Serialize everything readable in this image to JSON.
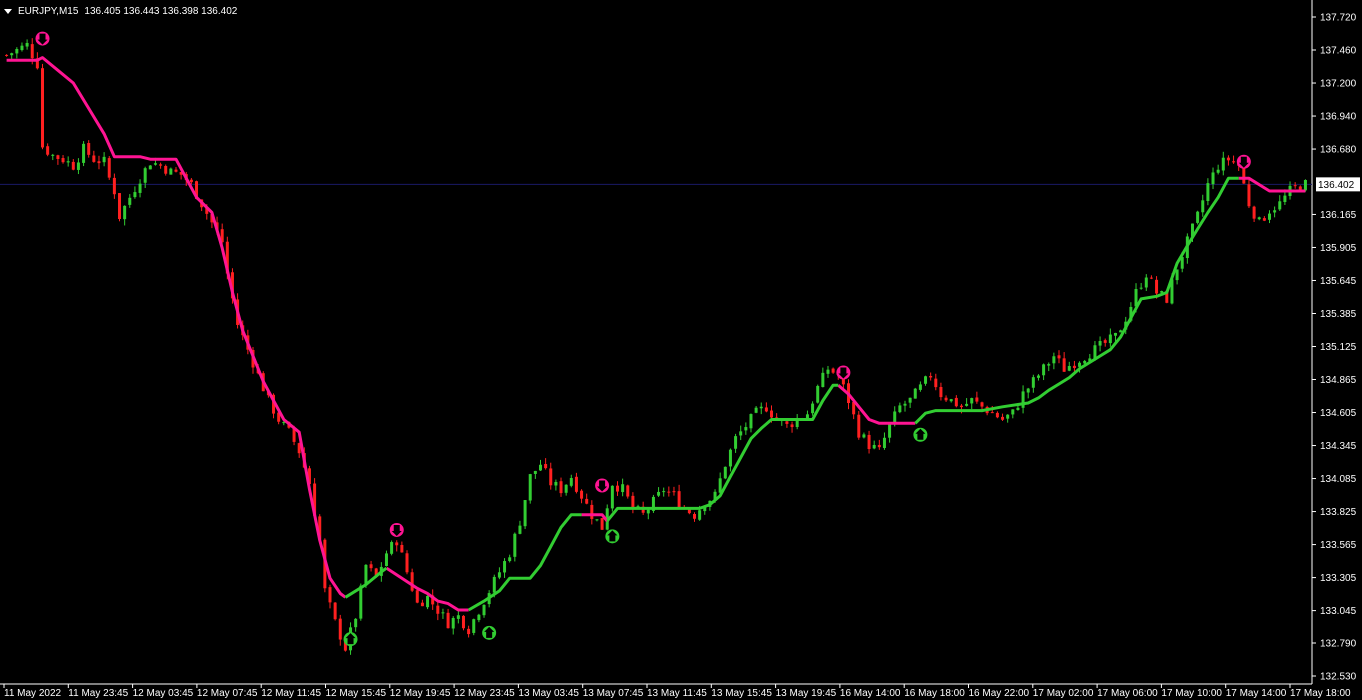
{
  "header": {
    "symbol": "EURJPY,M15",
    "ohlc": "136.405 136.443 136.398 136.402"
  },
  "colors": {
    "background": "#000000",
    "bull": "#32cd32",
    "bear": "#ff2020",
    "trail_up": "#32cd32",
    "trail_down": "#ff1493",
    "axis": "#ffffff",
    "price_line": "#1a1a66"
  },
  "chart_data": {
    "type": "line",
    "symbol": "EURJPY",
    "timeframe": "M15",
    "y_ticks": [
      "137.720",
      "137.460",
      "137.200",
      "136.940",
      "136.680",
      "136.402",
      "136.165",
      "135.905",
      "135.645",
      "135.385",
      "135.125",
      "134.865",
      "134.605",
      "134.345",
      "134.085",
      "133.825",
      "133.565",
      "133.305",
      "133.045",
      "132.790",
      "132.530"
    ],
    "ylim": [
      132.53,
      137.72
    ],
    "current_price": "136.402",
    "x_ticks": [
      "11 May 2022",
      "11 May 23:45",
      "12 May 03:45",
      "12 May 07:45",
      "12 May 11:45",
      "12 May 15:45",
      "12 May 19:45",
      "12 May 23:45",
      "13 May 03:45",
      "13 May 07:45",
      "13 May 11:45",
      "13 May 15:45",
      "13 May 19:45",
      "16 May 14:00",
      "16 May 18:00",
      "16 May 22:00",
      "17 May 02:00",
      "17 May 06:00",
      "17 May 10:00",
      "17 May 14:00",
      "17 May 18:00"
    ],
    "close_path": [
      [
        0,
        137.42
      ],
      [
        4,
        137.5
      ],
      [
        6,
        137.35
      ],
      [
        7,
        136.7
      ],
      [
        9,
        136.63
      ],
      [
        11,
        136.6
      ],
      [
        13,
        136.55
      ],
      [
        15,
        136.68
      ],
      [
        17,
        136.6
      ],
      [
        19,
        136.58
      ],
      [
        20,
        136.45
      ],
      [
        21,
        136.35
      ],
      [
        22,
        136.15
      ],
      [
        24,
        136.3
      ],
      [
        26,
        136.45
      ],
      [
        28,
        136.58
      ],
      [
        30,
        136.55
      ],
      [
        32,
        136.5
      ],
      [
        34,
        136.48
      ],
      [
        36,
        136.4
      ],
      [
        38,
        136.25
      ],
      [
        40,
        136.1
      ],
      [
        42,
        135.95
      ],
      [
        43,
        135.7
      ],
      [
        45,
        135.3
      ],
      [
        47,
        135.1
      ],
      [
        49,
        134.9
      ],
      [
        51,
        134.7
      ],
      [
        53,
        134.55
      ],
      [
        55,
        134.45
      ],
      [
        57,
        134.3
      ],
      [
        59,
        134.05
      ],
      [
        61,
        133.6
      ],
      [
        62,
        133.2
      ],
      [
        64,
        132.95
      ],
      [
        66,
        132.75
      ],
      [
        68,
        133.0
      ],
      [
        70,
        133.4
      ],
      [
        72,
        133.3
      ],
      [
        74,
        133.5
      ],
      [
        76,
        133.6
      ],
      [
        78,
        133.35
      ],
      [
        80,
        133.1
      ],
      [
        82,
        133.15
      ],
      [
        84,
        133.05
      ],
      [
        86,
        132.95
      ],
      [
        88,
        133.0
      ],
      [
        90,
        132.9
      ],
      [
        92,
        133.05
      ],
      [
        94,
        133.2
      ],
      [
        96,
        133.35
      ],
      [
        98,
        133.5
      ],
      [
        100,
        133.75
      ],
      [
        102,
        134.1
      ],
      [
        104,
        134.2
      ],
      [
        106,
        134.05
      ],
      [
        108,
        134.0
      ],
      [
        110,
        134.1
      ],
      [
        112,
        133.95
      ],
      [
        114,
        133.8
      ],
      [
        116,
        133.7
      ],
      [
        118,
        134.05
      ],
      [
        120,
        134.0
      ],
      [
        122,
        133.85
      ],
      [
        124,
        133.8
      ],
      [
        126,
        133.9
      ],
      [
        128,
        134.0
      ],
      [
        130,
        133.95
      ],
      [
        132,
        133.85
      ],
      [
        134,
        133.8
      ],
      [
        136,
        133.9
      ],
      [
        138,
        133.95
      ],
      [
        140,
        134.2
      ],
      [
        142,
        134.4
      ],
      [
        144,
        134.5
      ],
      [
        146,
        134.6
      ],
      [
        148,
        134.65
      ],
      [
        150,
        134.55
      ],
      [
        152,
        134.5
      ],
      [
        154,
        134.55
      ],
      [
        156,
        134.6
      ],
      [
        158,
        134.8
      ],
      [
        160,
        134.95
      ],
      [
        162,
        134.9
      ],
      [
        164,
        134.7
      ],
      [
        166,
        134.45
      ],
      [
        168,
        134.35
      ],
      [
        170,
        134.3
      ],
      [
        172,
        134.5
      ],
      [
        174,
        134.65
      ],
      [
        176,
        134.7
      ],
      [
        178,
        134.8
      ],
      [
        180,
        134.9
      ],
      [
        182,
        134.75
      ],
      [
        184,
        134.7
      ],
      [
        186,
        134.65
      ],
      [
        188,
        134.7
      ],
      [
        190,
        134.65
      ],
      [
        192,
        134.6
      ],
      [
        194,
        134.55
      ],
      [
        196,
        134.6
      ],
      [
        198,
        134.75
      ],
      [
        200,
        134.85
      ],
      [
        202,
        134.95
      ],
      [
        204,
        135.05
      ],
      [
        206,
        134.95
      ],
      [
        208,
        135.0
      ],
      [
        210,
        135.05
      ],
      [
        212,
        135.1
      ],
      [
        214,
        135.15
      ],
      [
        216,
        135.2
      ],
      [
        218,
        135.35
      ],
      [
        220,
        135.55
      ],
      [
        222,
        135.7
      ],
      [
        224,
        135.55
      ],
      [
        226,
        135.5
      ],
      [
        228,
        135.75
      ],
      [
        230,
        135.95
      ],
      [
        232,
        136.15
      ],
      [
        234,
        136.4
      ],
      [
        236,
        136.55
      ],
      [
        238,
        136.6
      ],
      [
        240,
        136.55
      ],
      [
        242,
        136.25
      ],
      [
        244,
        136.1
      ],
      [
        246,
        136.2
      ],
      [
        248,
        136.25
      ],
      [
        250,
        136.35
      ],
      [
        252,
        136.4
      ],
      [
        253,
        136.402
      ]
    ],
    "series": [
      {
        "role": "trail_stop_down",
        "segments": [
          [
            [
              0,
              137.38
            ],
            [
              6,
              137.38
            ],
            [
              7,
              137.4
            ],
            [
              10,
              137.3
            ],
            [
              13,
              137.2
            ],
            [
              16,
              137.0
            ],
            [
              19,
              136.8
            ],
            [
              21,
              136.62
            ],
            [
              26,
              136.62
            ],
            [
              28,
              136.6
            ],
            [
              33,
              136.6
            ],
            [
              35,
              136.45
            ],
            [
              37,
              136.3
            ],
            [
              40,
              136.18
            ],
            [
              42,
              135.9
            ],
            [
              44,
              135.55
            ],
            [
              46,
              135.25
            ],
            [
              48,
              135.05
            ],
            [
              50,
              134.85
            ],
            [
              52,
              134.7
            ],
            [
              54,
              134.55
            ],
            [
              57,
              134.45
            ],
            [
              59,
              134.0
            ],
            [
              61,
              133.6
            ],
            [
              63,
              133.3
            ],
            [
              65,
              133.18
            ],
            [
              66,
              133.15
            ]
          ],
          [
            [
              74,
              133.38
            ],
            [
              77,
              133.3
            ],
            [
              80,
              133.22
            ],
            [
              82,
              133.18
            ],
            [
              84,
              133.12
            ],
            [
              86,
              133.1
            ],
            [
              88,
              133.05
            ],
            [
              90,
              133.05
            ]
          ],
          [
            [
              112,
              133.8
            ],
            [
              116,
              133.8
            ],
            [
              117,
              133.75
            ]
          ],
          [
            [
              162,
              134.82
            ],
            [
              164,
              134.75
            ],
            [
              166,
              134.65
            ],
            [
              168,
              134.55
            ],
            [
              170,
              134.52
            ],
            [
              177,
              134.52
            ]
          ],
          [
            [
              240,
              136.45
            ],
            [
              242,
              136.45
            ],
            [
              244,
              136.4
            ],
            [
              246,
              136.35
            ],
            [
              248,
              136.35
            ],
            [
              250,
              136.35
            ],
            [
              253,
              136.35
            ]
          ]
        ]
      },
      {
        "role": "trail_stop_up",
        "segments": [
          [
            [
              66,
              133.15
            ],
            [
              70,
              133.25
            ],
            [
              73,
              133.35
            ],
            [
              74,
              133.38
            ]
          ],
          [
            [
              90,
              133.05
            ],
            [
              93,
              133.12
            ],
            [
              96,
              133.2
            ],
            [
              98,
              133.3
            ],
            [
              102,
              133.3
            ],
            [
              104,
              133.4
            ],
            [
              106,
              133.55
            ],
            [
              108,
              133.7
            ],
            [
              110,
              133.8
            ],
            [
              112,
              133.8
            ]
          ],
          [
            [
              117,
              133.75
            ],
            [
              119,
              133.85
            ],
            [
              121,
              133.85
            ],
            [
              135,
              133.85
            ],
            [
              137,
              133.88
            ],
            [
              139,
              133.95
            ],
            [
              141,
              134.1
            ],
            [
              143,
              134.25
            ],
            [
              145,
              134.4
            ],
            [
              147,
              134.48
            ],
            [
              149,
              134.55
            ],
            [
              157,
              134.55
            ],
            [
              159,
              134.7
            ],
            [
              161,
              134.82
            ],
            [
              162,
              134.82
            ]
          ],
          [
            [
              177,
              134.52
            ],
            [
              179,
              134.6
            ],
            [
              181,
              134.62
            ],
            [
              190,
              134.62
            ],
            [
              194,
              134.65
            ],
            [
              199,
              134.68
            ],
            [
              201,
              134.72
            ],
            [
              203,
              134.78
            ],
            [
              205,
              134.83
            ],
            [
              207,
              134.88
            ],
            [
              209,
              134.95
            ],
            [
              211,
              135.0
            ],
            [
              213,
              135.05
            ],
            [
              215,
              135.1
            ],
            [
              217,
              135.2
            ],
            [
              219,
              135.35
            ],
            [
              221,
              135.5
            ],
            [
              224,
              135.52
            ],
            [
              226,
              135.55
            ],
            [
              228,
              135.78
            ],
            [
              230,
              135.92
            ],
            [
              232,
              136.05
            ],
            [
              234,
              136.18
            ],
            [
              236,
              136.3
            ],
            [
              238,
              136.45
            ],
            [
              240,
              136.45
            ]
          ]
        ]
      }
    ],
    "signals": [
      {
        "type": "sell",
        "bar": 7,
        "price": 137.55
      },
      {
        "type": "buy",
        "bar": 67,
        "price": 132.82
      },
      {
        "type": "sell",
        "bar": 76,
        "price": 133.68
      },
      {
        "type": "buy",
        "bar": 94,
        "price": 132.87
      },
      {
        "type": "sell",
        "bar": 116,
        "price": 134.03
      },
      {
        "type": "buy",
        "bar": 118,
        "price": 133.63
      },
      {
        "type": "sell",
        "bar": 163,
        "price": 134.92
      },
      {
        "type": "buy",
        "bar": 178,
        "price": 134.43
      },
      {
        "type": "sell",
        "bar": 241,
        "price": 136.58
      }
    ],
    "xlabel": "",
    "ylabel": "",
    "grid": false
  }
}
